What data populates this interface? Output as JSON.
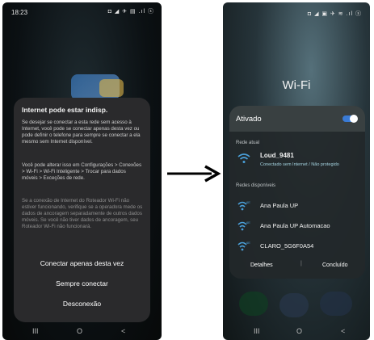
{
  "left_phone": {
    "status": {
      "time": "18:23",
      "icons": "◘ ◢ ✈ ▤ .ıl ⓢ"
    },
    "dialog": {
      "title": "Internet pode estar indisp.",
      "paragraph_1": "Se desejar se conectar a esta rede sem acesso à Internet, você pode se conectar apenas desta vez ou pode definir o telefone para sempre se conectar a ela mesmo sem Internet disponível.",
      "paragraph_2": "Você pode alterar isso em Configurações > Conexões > Wi-Fi > Wi-Fi Inteligente > Trocar para dados móveis > Exceções de rede.",
      "paragraph_3": "Se a conexão de Internet do Roteador Wi-Fi não estiver funcionando, verifique se a operadora mede os dados de ancoragem separadamente de outros dados móveis. Se você não tiver dados de ancoragem, seu Roteador Wi-Fi não funcionará.",
      "button_once": "Conectar apenas desta vez",
      "button_always": "Sempre conectar",
      "button_disconnect": "Desconexão"
    },
    "nav": {
      "recents": "III",
      "home": "O",
      "back": "<"
    }
  },
  "right_phone": {
    "status": {
      "icons": "◘ ◢ ▣ ✈ ≋ .ıl ⓢ"
    },
    "title": "Wi-Fi",
    "toggle_label": "Ativado",
    "toggle_on": true,
    "current_section": "Rede atual",
    "current_network": {
      "name": "Loud_9481",
      "status": "Conectado sem Internet / Não protegido"
    },
    "available_section": "Redes disponíveis",
    "networks": [
      {
        "name": "Ana Paula UP",
        "icon": "wifi-6e-icon"
      },
      {
        "name": "Ana Paula UP Automacao",
        "icon": "wifi-6e-icon"
      },
      {
        "name": "CLARO_5G6F0A54",
        "icon": "wifi-6e-icon"
      }
    ],
    "footer": {
      "details": "Detalhes",
      "separator": "|",
      "done": "Concluído"
    },
    "nav": {
      "recents": "III",
      "home": "O",
      "back": "<"
    }
  },
  "colors": {
    "accent": "#3a7bd5",
    "wifi_icon": "#4a9fd8",
    "dialog_bg": "#2a2a2c"
  }
}
